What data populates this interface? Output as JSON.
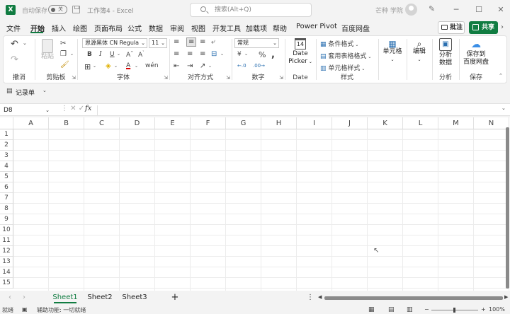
{
  "titlebar": {
    "autosave_label": "自动保存",
    "autosave_state": "关",
    "doc_title": "工作簿4 - Excel",
    "search_placeholder": "搜索(Alt+Q)",
    "user_name": "芒种 学院"
  },
  "menu": {
    "tabs": [
      "文件",
      "开始",
      "插入",
      "绘图",
      "页面布局",
      "公式",
      "数据",
      "审阅",
      "视图",
      "开发工具",
      "加载项",
      "帮助",
      "Power Pivot",
      "百度网盘"
    ],
    "active": "开始",
    "comment_label": "批注",
    "share_label": "共享"
  },
  "ribbon": {
    "groups": {
      "undo": "撤消",
      "clipboard": "剪贴板",
      "font": "字体",
      "align": "对齐方式",
      "number": "数字",
      "date": "Date",
      "styles": "样式",
      "cells": "单元格",
      "editing": "编辑",
      "analysis": "分析",
      "save": "保存"
    },
    "paste_label": "粘贴",
    "font_name": "思源黑体 CN Regula",
    "font_size": "11",
    "number_format": "常规",
    "date_picker_line1": "Date",
    "date_picker_line2": "Picker",
    "date_day": "14",
    "cond_format": "条件格式",
    "table_format": "套用表格格式",
    "cell_styles": "单元格样式",
    "cells_label": "单元格",
    "editing_label": "编辑",
    "analyze_line1": "分析",
    "analyze_line2": "数据",
    "save_line1": "保存到",
    "save_line2": "百度网盘"
  },
  "quickbar": {
    "record_label": "记录单"
  },
  "formula": {
    "name_box": "D8",
    "fx": "fx",
    "content": ""
  },
  "grid": {
    "columns": [
      "A",
      "B",
      "C",
      "D",
      "E",
      "F",
      "G",
      "H",
      "I",
      "J",
      "K",
      "L",
      "M",
      "N"
    ],
    "rows": [
      "1",
      "2",
      "3",
      "4",
      "5",
      "6",
      "7",
      "8",
      "9",
      "10",
      "11",
      "12",
      "13",
      "14",
      "15"
    ]
  },
  "sheets": {
    "tabs": [
      "Sheet1",
      "Sheet2",
      "Sheet3"
    ],
    "active": "Sheet1",
    "add": "+"
  },
  "status": {
    "ready": "就绪",
    "accessibility": "辅助功能: 一切就绪",
    "zoom": "100%"
  }
}
